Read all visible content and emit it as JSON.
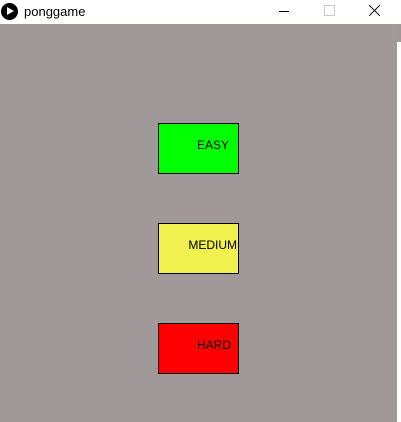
{
  "window": {
    "title": "ponggame",
    "icon": "play-circle-icon"
  },
  "colors": {
    "canvas_background": "#a19999",
    "easy": "#00ff00",
    "medium": "#f0f04f",
    "hard": "#ff0000"
  },
  "menu": {
    "buttons": [
      {
        "label": "EASY",
        "color": "#00ff00"
      },
      {
        "label": "MEDIUM",
        "color": "#f0f04f"
      },
      {
        "label": "HARD",
        "color": "#ff0000"
      }
    ]
  }
}
